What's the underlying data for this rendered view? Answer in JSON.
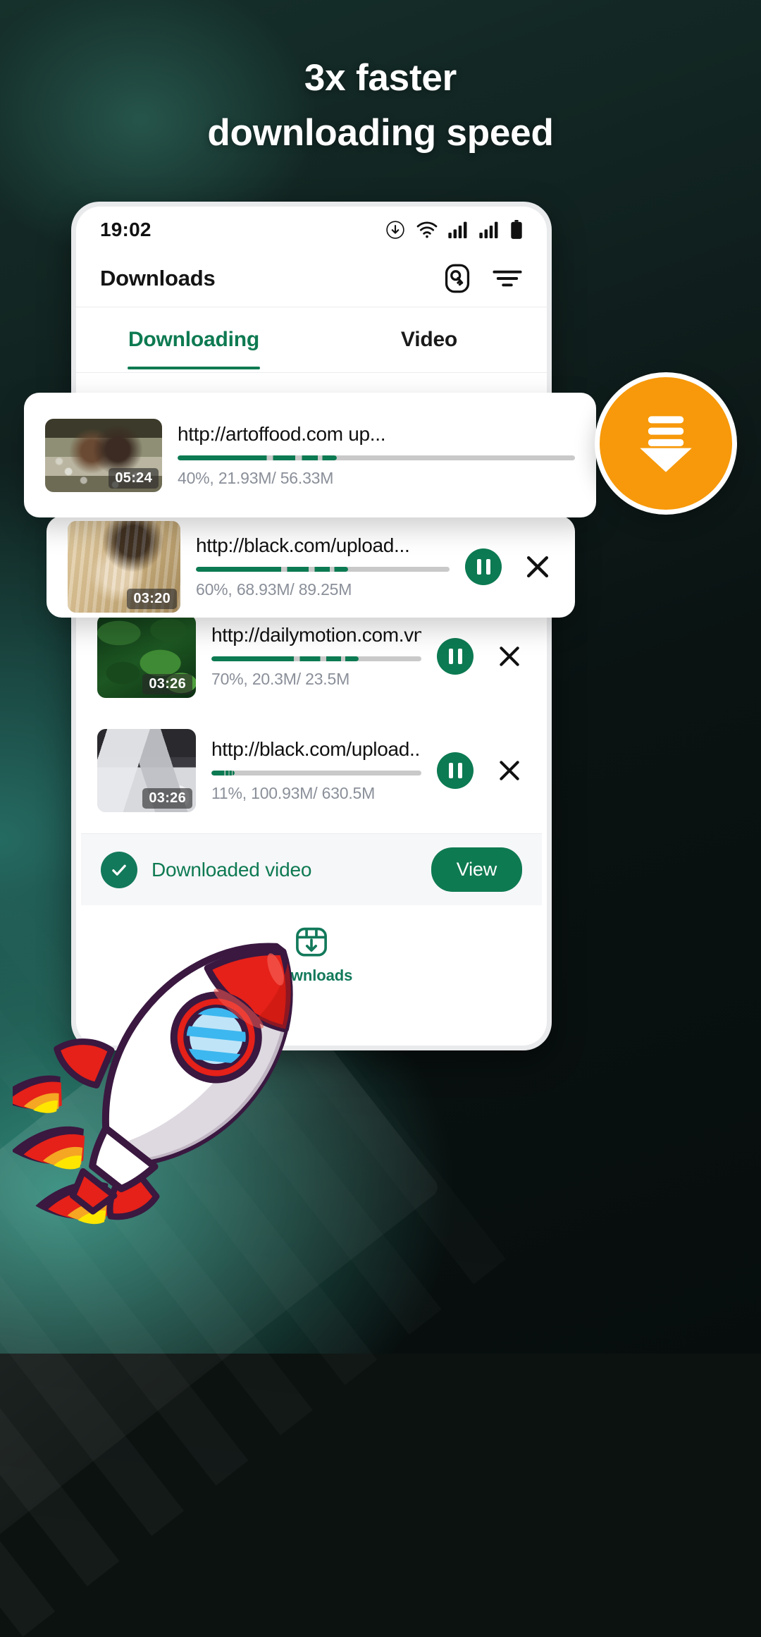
{
  "promo": {
    "headline_line1": "3x faster",
    "headline_line2": "downloading speed"
  },
  "colors": {
    "brand_green": "#0E7A52",
    "accent_orange": "#F7990A",
    "rocket_red": "#E32119"
  },
  "phone": {
    "statusbar": {
      "time": "19:02",
      "icons": [
        "download-circle-icon",
        "wifi-icon",
        "signal-icon",
        "signal-icon",
        "battery-icon"
      ]
    },
    "appbar": {
      "title": "Downloads",
      "actions": [
        "key-icon",
        "filter-icon"
      ]
    },
    "tabs": [
      {
        "label": "Downloading",
        "active": true
      },
      {
        "label": "Video",
        "active": false
      }
    ],
    "downloads": [
      {
        "url": "http://artoffood.com up...",
        "percent": 40,
        "downloaded": "21.93M",
        "total": "56.33M",
        "stats": "40%, 21.93M/ 56.33M",
        "duration": "05:24",
        "thumb": "couple-in-flower-field",
        "floating": true
      },
      {
        "url": "http://black.com/upload...",
        "percent": 60,
        "downloaded": "68.93M",
        "total": "89.25M",
        "stats": "60%, 68.93M/ 89.25M",
        "duration": "03:20",
        "thumb": "couple-in-wheat-field",
        "floating": true
      },
      {
        "url": "http://dailymotion.com.vn...",
        "percent": 70,
        "downloaded": "20.3M",
        "total": "23.5M",
        "stats": "70%, 20.3M/ 23.5M",
        "duration": "03:26",
        "thumb": "green-leaves",
        "floating": false
      },
      {
        "url": "http://black.com/upload...",
        "percent": 11,
        "downloaded": "100.93M",
        "total": "630.5M",
        "stats": "11%, 100.93M/ 630.5M",
        "duration": "03:26",
        "thumb": "hands-on-laptop",
        "floating": false
      }
    ],
    "banner": {
      "text": "Downloaded video",
      "button_label": "View",
      "icon": "check-circle-icon"
    },
    "bottom_nav": [
      {
        "label": "Downloads",
        "icon": "downloads-box-icon",
        "active": true
      }
    ],
    "fab": {
      "icon": "download-arrow-icon"
    }
  }
}
